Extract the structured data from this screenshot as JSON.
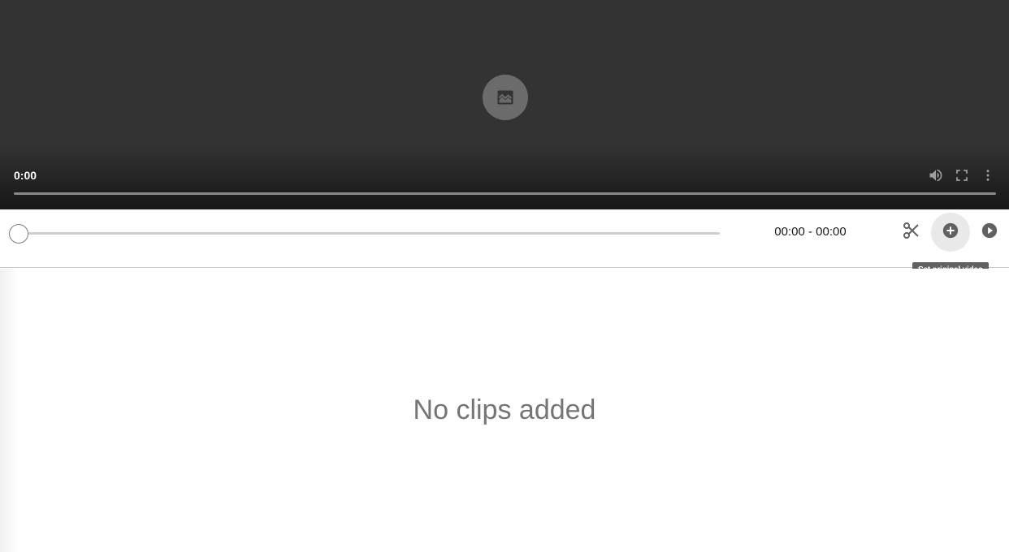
{
  "player": {
    "current_time": "0:00",
    "playback_progress": 0,
    "icons": {
      "center": "broken-media-icon",
      "volume": "volume-icon",
      "fullscreen": "fullscreen-icon",
      "more": "more-vert-icon"
    }
  },
  "editor": {
    "time_range": "00:00 - 00:00",
    "trim_position": 0,
    "tools": [
      {
        "name": "cut",
        "icon": "scissors-icon"
      },
      {
        "name": "add",
        "icon": "add-circle-icon"
      },
      {
        "name": "play",
        "icon": "play-circle-icon"
      }
    ],
    "tooltip": "Set original video"
  },
  "clips": {
    "empty_message": "No clips added"
  },
  "colors": {
    "player_background": "#333333",
    "icon_gray": "#616161",
    "empty_text": "#757575"
  }
}
